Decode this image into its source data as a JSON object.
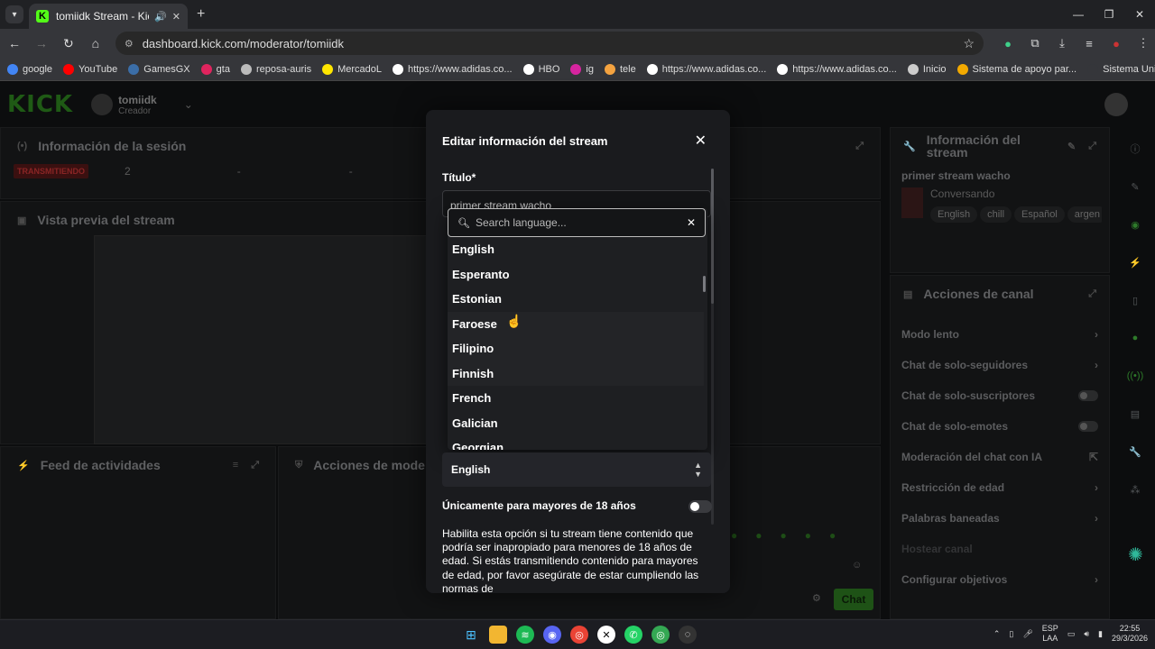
{
  "browser": {
    "tab_title": "tomiidk Stream - Kick Dashbo",
    "url": "dashboard.kick.com/moderator/tomiidk",
    "bookmarks": [
      {
        "label": "google",
        "color": "#4285f4"
      },
      {
        "label": "YouTube",
        "color": "#ff0000"
      },
      {
        "label": "GamesGX",
        "color": "#3b6ea8"
      },
      {
        "label": "gta",
        "color": "#e0245e"
      },
      {
        "label": "reposa-auris",
        "color": "#bbbbbb"
      },
      {
        "label": "MercadoL",
        "color": "#ffe600"
      },
      {
        "label": "https://www.adidas.co...",
        "color": "#ffffff"
      },
      {
        "label": "HBO",
        "color": "#ffffff"
      },
      {
        "label": "ig",
        "color": "#d6249f"
      },
      {
        "label": "tele",
        "color": "#f4a340"
      },
      {
        "label": "https://www.adidas.co...",
        "color": "#ffffff"
      },
      {
        "label": "https://www.adidas.co...",
        "color": "#ffffff"
      },
      {
        "label": "Inicio",
        "color": "#cccccc"
      },
      {
        "label": "Sistema de apoyo par...",
        "color": "#f2a900"
      },
      {
        "label": "Sistema Unificado de...",
        "color": "#35363a"
      }
    ]
  },
  "dashboard": {
    "username": "tomiidk",
    "role": "Creador",
    "session_title": "Información de la sesión",
    "live_badge": "TRANSMITIENDO",
    "viewers": "2",
    "dash1": "-",
    "dash2": "-",
    "preview_title": "Vista previa del stream",
    "feed_title": "Feed de actividades",
    "mod_actions_title": "Acciones de mode",
    "stream_info_title": "Información del stream",
    "stream_name": "primer stream wacho",
    "category": "Conversando",
    "tags": [
      "English",
      "chill",
      "Español",
      "argen"
    ],
    "channel_actions_title": "Acciones de canal",
    "channel_actions": [
      {
        "label": "Modo lento",
        "control": "chevron"
      },
      {
        "label": "Chat de solo-seguidores",
        "control": "chevron"
      },
      {
        "label": "Chat de solo-suscriptores",
        "control": "toggle"
      },
      {
        "label": "Chat de solo-emotes",
        "control": "toggle"
      },
      {
        "label": "Moderación del chat con IA",
        "control": "external"
      },
      {
        "label": "Restricción de edad",
        "control": "chevron"
      },
      {
        "label": "Palabras baneadas",
        "control": "chevron"
      },
      {
        "label": "Hostear canal",
        "control": "none"
      },
      {
        "label": "Configurar objetivos",
        "control": "chevron"
      }
    ],
    "chat_button": "Chat"
  },
  "modal": {
    "title": "Editar información del stream",
    "title_field_label": "Título*",
    "title_value": "primer stream wacho",
    "search_placeholder": "Search language...",
    "languages": [
      "English",
      "Esperanto",
      "Estonian",
      "Faroese",
      "Filipino",
      "Finnish",
      "French",
      "Galician",
      "Georgian"
    ],
    "hovered_language": "Faroese",
    "selected_language": "English",
    "adult_label": "Únicamente para mayores de 18 años",
    "adult_enabled": false,
    "adult_description": "Habilita esta opción si tu stream tiene contenido que podría ser inapropiado para menores de 18 años de edad. Si estás transmitiendo contenido para mayores de edad, por favor asegúrate de estar cumpliendo las normas de"
  },
  "taskbar": {
    "lang_top": "ESP",
    "lang_bottom": "LAA",
    "time": "22:55",
    "date": "29/3/2026"
  },
  "colors": {
    "kick_green": "#53fc18",
    "modal_bg": "#1a1b1e",
    "live_red": "#8a2525"
  }
}
